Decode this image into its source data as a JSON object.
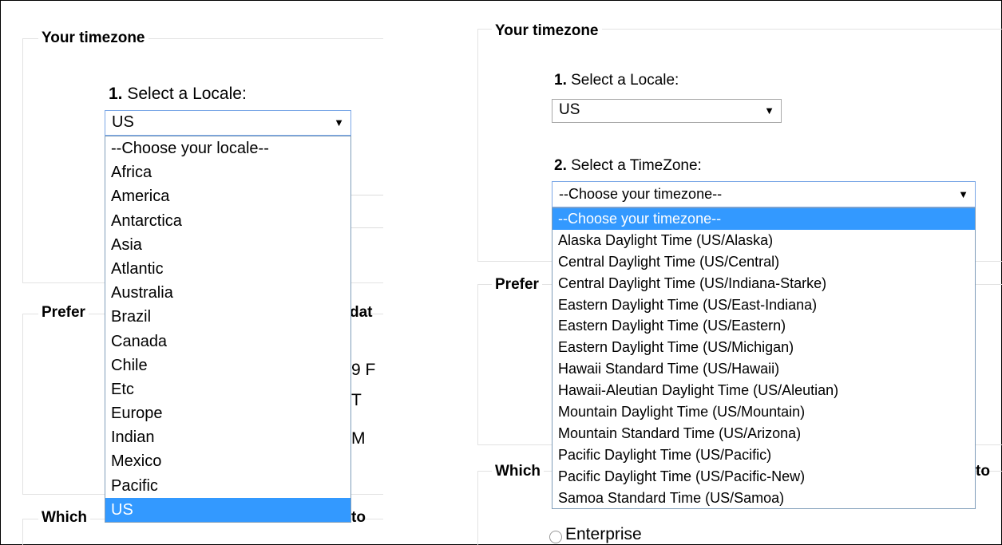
{
  "left": {
    "legend": "Your timezone",
    "step1_num": "1.",
    "step1_text": " Select a Locale:",
    "locale_value": "US",
    "arrow": "▼",
    "locale_options": [
      "--Choose your locale--",
      "Africa",
      "America",
      "Antarctica",
      "Asia",
      "Atlantic",
      "Australia",
      "Brazil",
      "Canada",
      "Chile",
      "Etc",
      "Europe",
      "Indian",
      "Mexico",
      "Pacific",
      "US"
    ],
    "selected_index": 15,
    "legend_prefs": "Prefer",
    "legend_which": "Which",
    "frag_dat": "dat",
    "frag_9f": "9 F",
    "frag_t": "T",
    "frag_m": "M",
    "frag_to": "to"
  },
  "right": {
    "legend": "Your timezone",
    "step1_num": "1.",
    "step1_text": " Select a Locale:",
    "locale_value": "US",
    "step2_num": "2.",
    "step2_text": " Select a TimeZone:",
    "timezone_value": "--Choose your timezone--",
    "arrow": "▼",
    "timezone_options": [
      "--Choose your timezone--",
      "Alaska Daylight Time (US/Alaska)",
      "Central Daylight Time (US/Central)",
      "Central Daylight Time (US/Indiana-Starke)",
      "Eastern Daylight Time (US/East-Indiana)",
      "Eastern Daylight Time (US/Eastern)",
      "Eastern Daylight Time (US/Michigan)",
      "Hawaii Standard Time (US/Hawaii)",
      "Hawaii-Aleutian Daylight Time (US/Aleutian)",
      "Mountain Daylight Time (US/Mountain)",
      "Mountain Standard Time (US/Arizona)",
      "Pacific Daylight Time (US/Pacific)",
      "Pacific Daylight Time (US/Pacific-New)",
      "Samoa Standard Time (US/Samoa)"
    ],
    "selected_index": 0,
    "legend_prefs": "Prefer",
    "legend_which": "Which",
    "frag_to": "to",
    "frag_enterprise": "Enterprise"
  },
  "colors": {
    "highlight": "#3399ff",
    "focus_border": "#7aa7e6",
    "panel_border": "#e2e2e2"
  }
}
